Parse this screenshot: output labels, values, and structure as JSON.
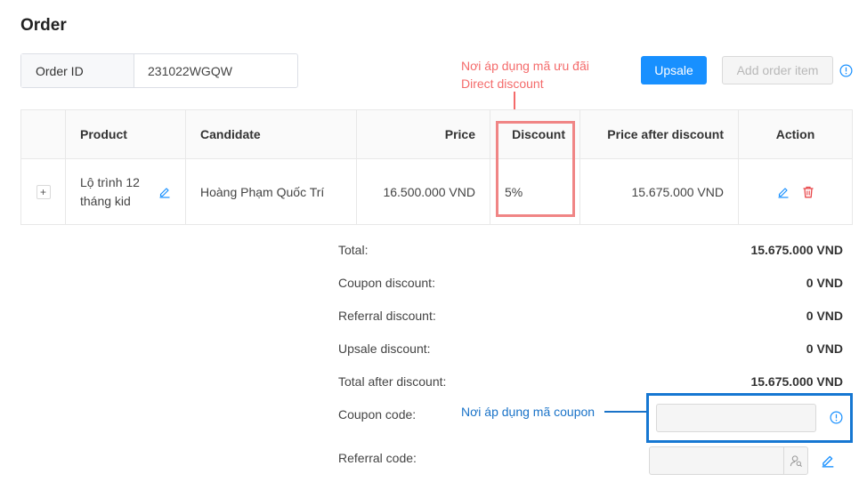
{
  "page": {
    "title": "Order"
  },
  "order_id": {
    "label": "Order ID",
    "value": "231022WGQW"
  },
  "toolbar": {
    "upsale_label": "Upsale",
    "add_item_label": "Add order item"
  },
  "annotations": {
    "direct_discount_line1": "Nơi áp dụng mã ưu đãi",
    "direct_discount_line2": "Direct discount",
    "coupon": "Nơi áp dụng mã coupon"
  },
  "table": {
    "columns": {
      "product": "Product",
      "candidate": "Candidate",
      "price": "Price",
      "discount": "Discount",
      "price_after": "Price after discount",
      "action": "Action"
    },
    "rows": [
      {
        "expand": "+",
        "product": "Lộ trình 12 tháng kid",
        "candidate": "Hoàng Phạm Quốc Trí",
        "price": "16.500.000 VND",
        "discount": "5%",
        "price_after": "15.675.000 VND"
      }
    ]
  },
  "summary": {
    "total_label": "Total:",
    "total_value": "15.675.000 VND",
    "coupon_discount_label": "Coupon discount:",
    "coupon_discount_value": "0 VND",
    "referral_discount_label": "Referral discount:",
    "referral_discount_value": "0 VND",
    "upsale_discount_label": "Upsale discount:",
    "upsale_discount_value": "0 VND",
    "total_after_label": "Total after discount:",
    "total_after_value": "15.675.000 VND",
    "coupon_code_label": "Coupon code:",
    "referral_code_label": "Referral code:"
  },
  "inputs": {
    "coupon_value": "",
    "referral_value": ""
  },
  "colors": {
    "primary": "#1890ff",
    "annotation_red": "#f46b6b",
    "annotation_blue": "#1a73c8",
    "delete": "#e8474a"
  },
  "icons": [
    "info-icon",
    "edit-icon",
    "delete-icon",
    "user-search-icon"
  ]
}
